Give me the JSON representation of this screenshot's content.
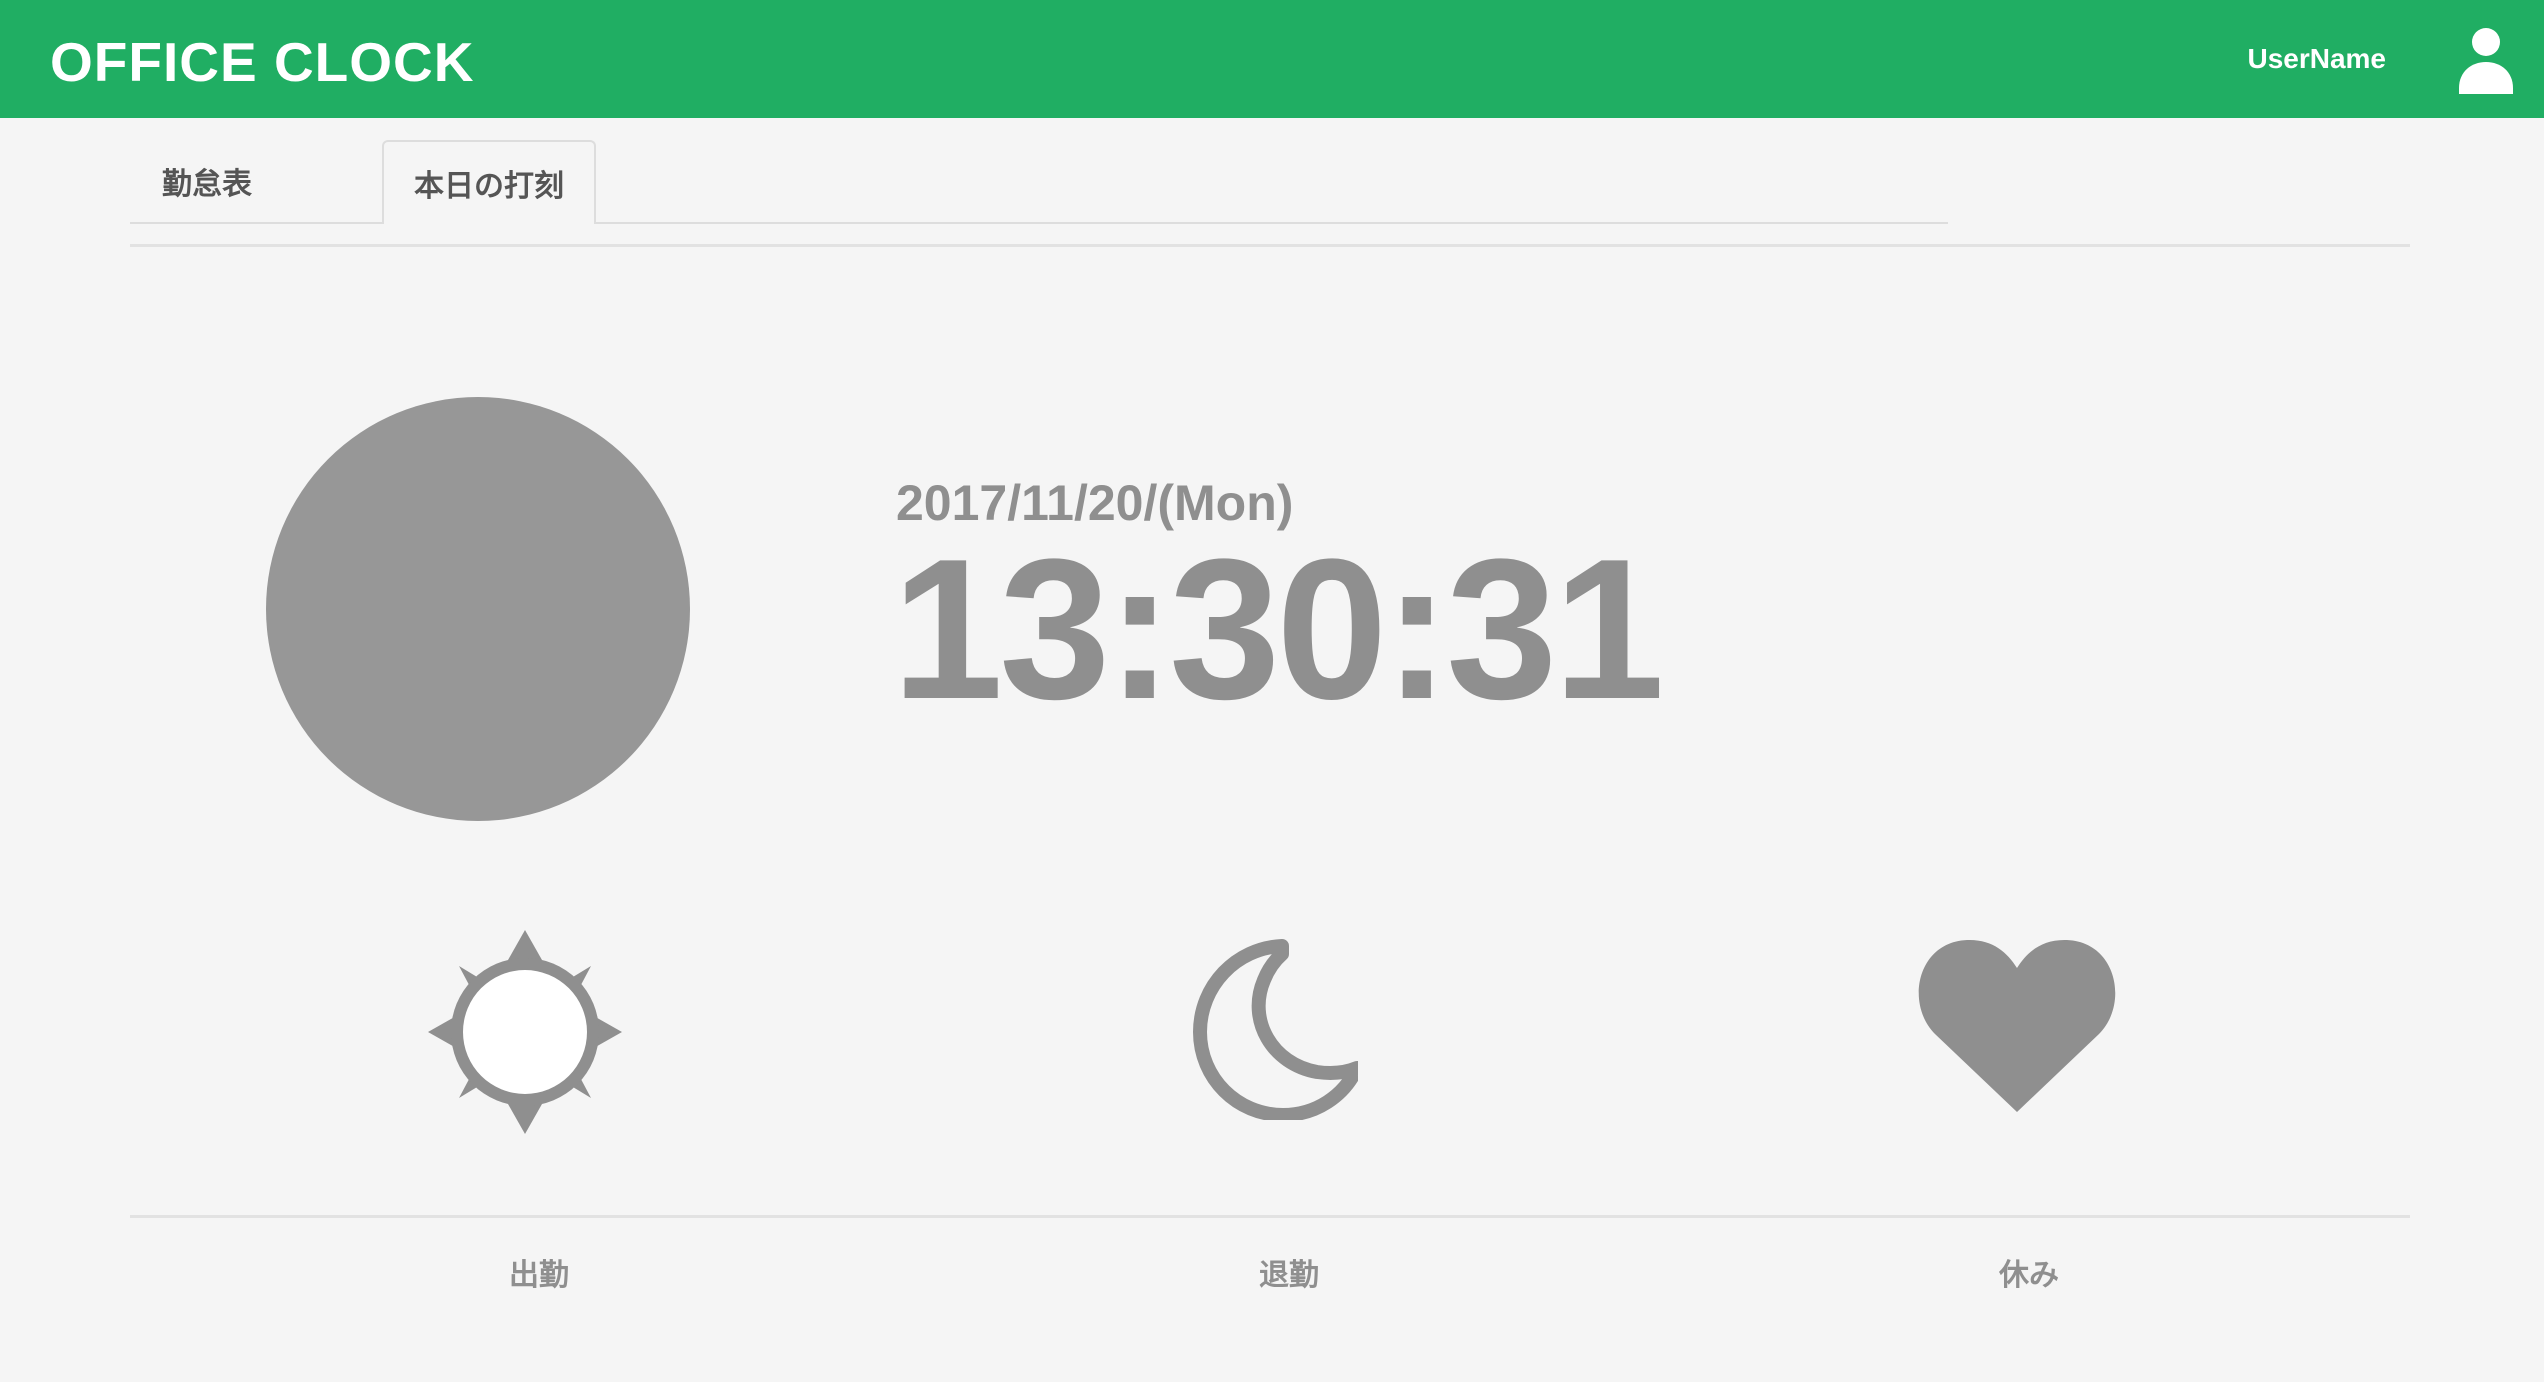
{
  "header": {
    "brand": "OFFICE CLOCK",
    "username": "UserName",
    "icons": {
      "user": "user-icon"
    },
    "colors": {
      "background": "#20ae63",
      "text": "#ffffff"
    }
  },
  "tabs": [
    {
      "label": "勤怠表"
    },
    {
      "label": "本日の打刻"
    }
  ],
  "clock": {
    "date": "2017/11/20/(Mon)",
    "time": "13:30:31"
  },
  "actions": [
    {
      "icon": "sun-icon",
      "label": "出勤"
    },
    {
      "icon": "moon-icon",
      "label": "退勤"
    },
    {
      "icon": "heart-icon",
      "label": "休み"
    }
  ],
  "colors": {
    "page_background": "#f5f5f5",
    "avatar": "#979797",
    "text_gray": "#8f8f8f",
    "divider": "#e2e2e2"
  }
}
